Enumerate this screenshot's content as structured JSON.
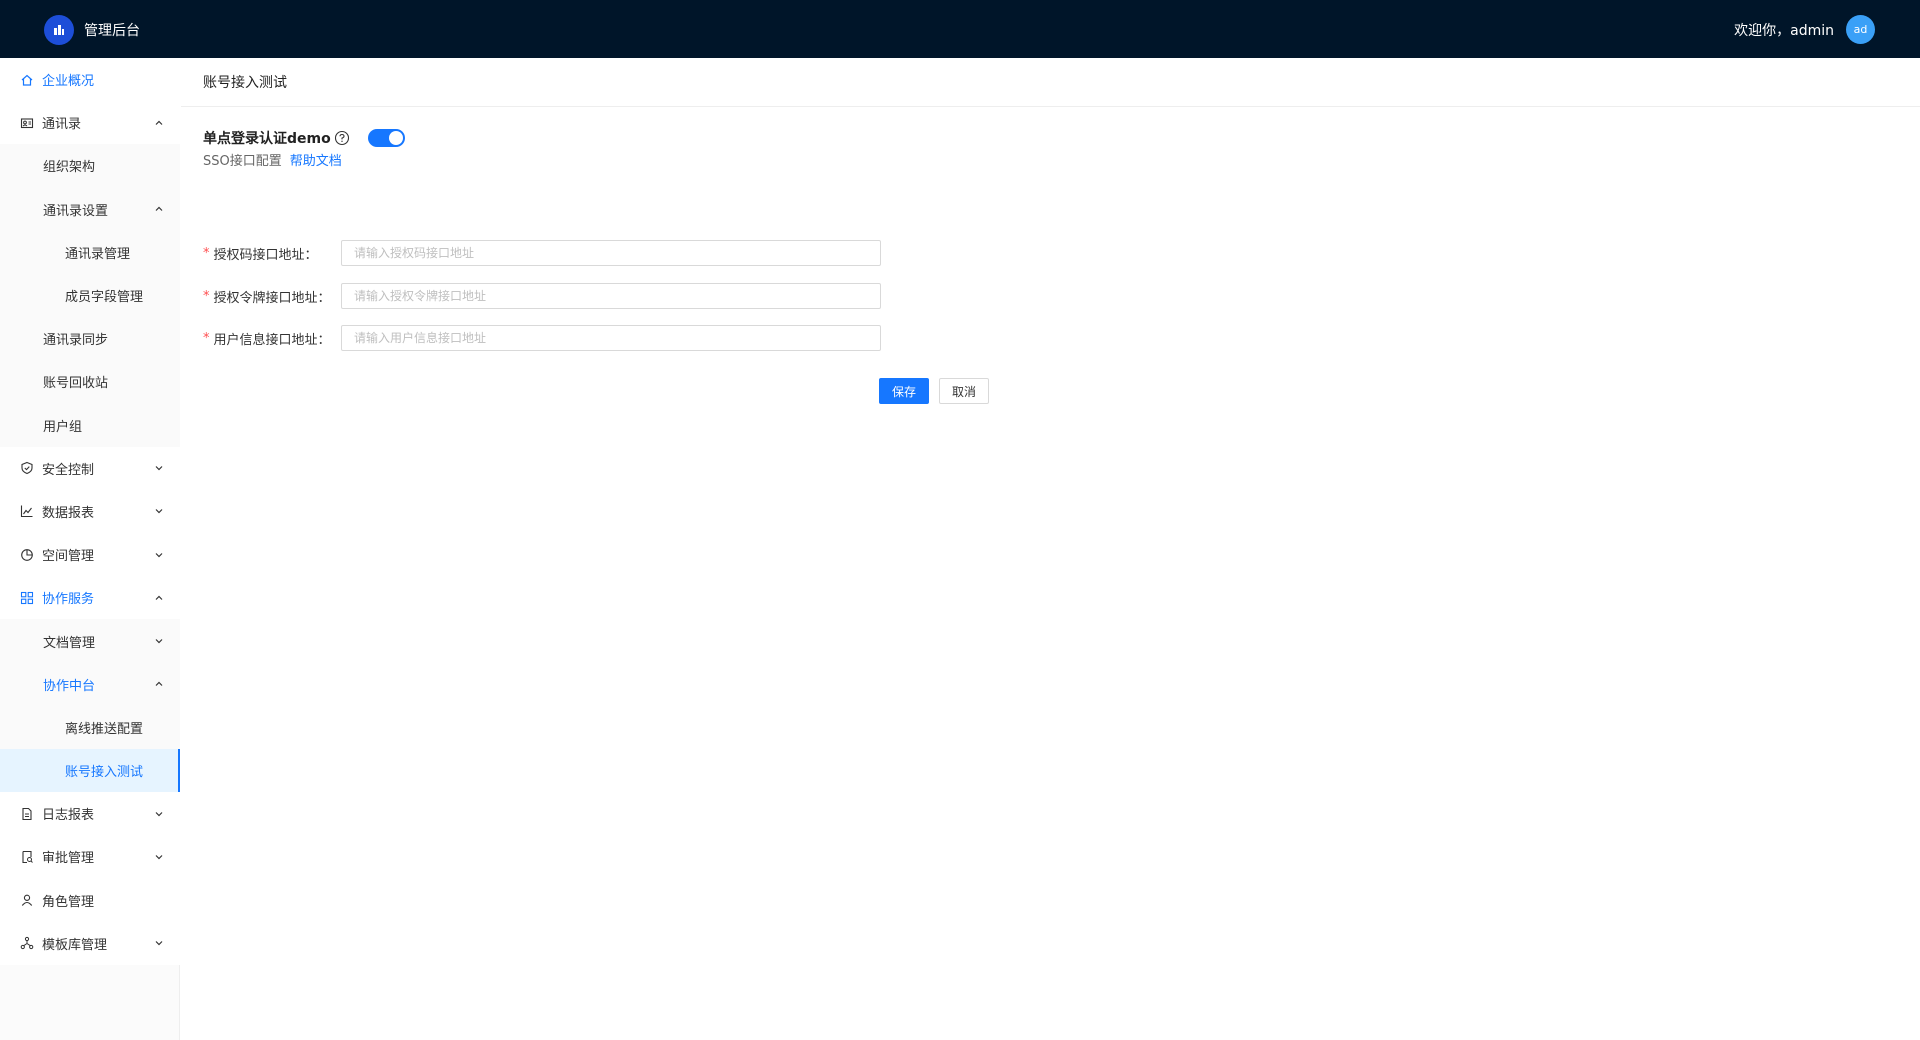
{
  "header": {
    "title": "管理后台",
    "welcome": "欢迎你，admin",
    "avatar_text": "ad"
  },
  "sidebar": {
    "items": [
      {
        "label": "企业概况",
        "icon": "home-icon",
        "level": 1,
        "active": true
      },
      {
        "label": "通讯录",
        "icon": "contacts-icon",
        "level": 1,
        "chevron": "up"
      },
      {
        "label": "组织架构",
        "level": 2
      },
      {
        "label": "通讯录设置",
        "level": 2,
        "chevron": "up"
      },
      {
        "label": "通讯录管理",
        "level": 3
      },
      {
        "label": "成员字段管理",
        "level": 3
      },
      {
        "label": "通讯录同步",
        "level": 2
      },
      {
        "label": "账号回收站",
        "level": 2
      },
      {
        "label": "用户组",
        "level": 2
      },
      {
        "label": "安全控制",
        "icon": "shield-icon",
        "level": 1,
        "chevron": "down"
      },
      {
        "label": "数据报表",
        "icon": "line-chart-icon",
        "level": 1,
        "chevron": "down"
      },
      {
        "label": "空间管理",
        "icon": "pie-chart-icon",
        "level": 1,
        "chevron": "down"
      },
      {
        "label": "协作服务",
        "icon": "grid-icon",
        "level": 1,
        "chevron": "up",
        "active": true
      },
      {
        "label": "文档管理",
        "level": 2,
        "chevron": "down"
      },
      {
        "label": "协作中台",
        "level": 2,
        "chevron": "up",
        "active": true
      },
      {
        "label": "离线推送配置",
        "level": 3
      },
      {
        "label": "账号接入测试",
        "level": 3,
        "selected": true
      },
      {
        "label": "日志报表",
        "icon": "file-icon",
        "level": 1,
        "chevron": "down"
      },
      {
        "label": "审批管理",
        "icon": "audit-icon",
        "level": 1,
        "chevron": "down"
      },
      {
        "label": "角色管理",
        "icon": "user-icon",
        "level": 1
      },
      {
        "label": "模板库管理",
        "icon": "cluster-icon",
        "level": 1,
        "chevron": "down"
      }
    ]
  },
  "page": {
    "title": "账号接入测试",
    "sso_title": "单点登录认证demo",
    "sso_subtitle": "SSO接口配置",
    "help_link": "帮助文档",
    "toggle_on": true,
    "fields": [
      {
        "label": "授权码接口地址：",
        "placeholder": "请输入授权码接口地址",
        "required": true
      },
      {
        "label": "授权令牌接口地址：",
        "placeholder": "请输入授权令牌接口地址",
        "required": true
      },
      {
        "label": "用户信息接口地址：",
        "placeholder": "请输入用户信息接口地址",
        "required": true
      }
    ],
    "save_label": "保存",
    "cancel_label": "取消"
  },
  "colors": {
    "header_bg": "#001529",
    "accent": "#1677ff",
    "required": "#ff4d4f"
  }
}
